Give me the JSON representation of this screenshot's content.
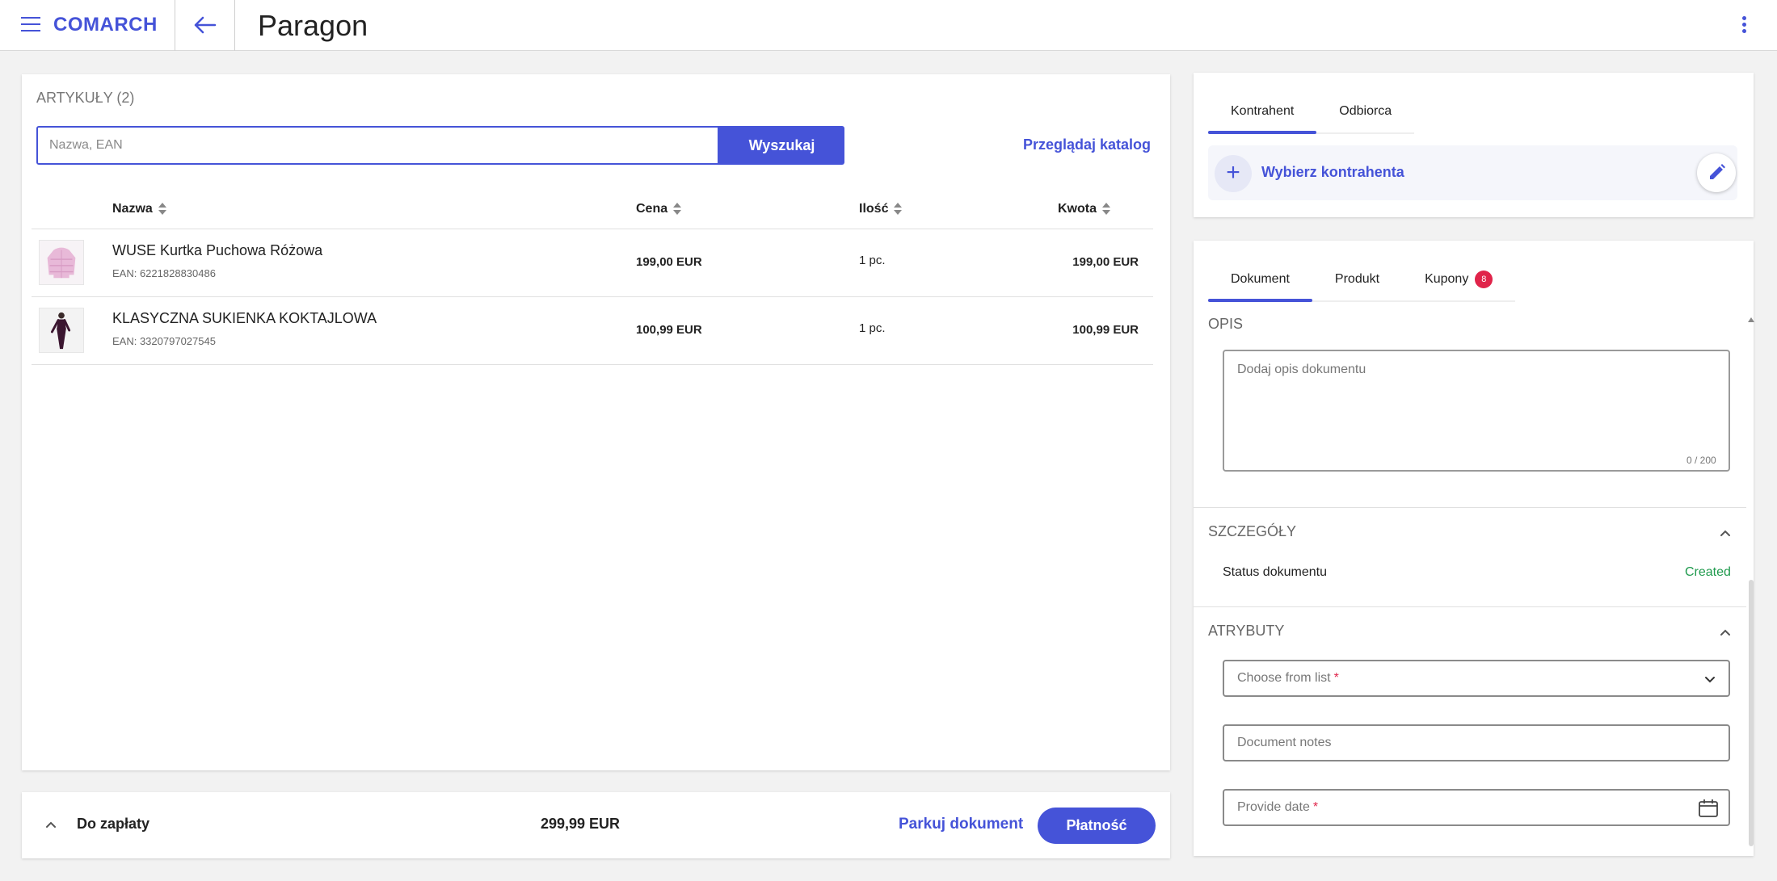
{
  "header": {
    "logo": "COMARCH",
    "title": "Paragon"
  },
  "articles": {
    "heading": "ARTYKUŁY (2)",
    "search_placeholder": "Nazwa, EAN",
    "search_button": "Wyszukaj",
    "catalog_link": "Przeglądaj katalog",
    "columns": {
      "name": "Nazwa",
      "price": "Cena",
      "qty": "Ilość",
      "amount": "Kwota"
    },
    "items": [
      {
        "name": "WUSE Kurtka Puchowa Różowa",
        "ean": "EAN: 6221828830486",
        "price": "199,00 EUR",
        "qty": "1 pc.",
        "amount": "199,00 EUR"
      },
      {
        "name": "KLASYCZNA SUKIENKA KOKTAJLOWA",
        "ean": "EAN: 3320797027545",
        "price": "100,99 EUR",
        "qty": "1 pc.",
        "amount": "100,99 EUR"
      }
    ]
  },
  "footer": {
    "due_label": "Do zapłaty",
    "due_amount": "299,99 EUR",
    "park_label": "Parkuj dokument",
    "pay_label": "Płatność"
  },
  "contractor": {
    "tabs": [
      "Kontrahent",
      "Odbiorca"
    ],
    "choose_label": "Wybierz kontrahenta"
  },
  "document": {
    "tabs": [
      "Dokument",
      "Produkt",
      "Kupony"
    ],
    "coupons_badge": "8",
    "description_title": "OPIS",
    "description_placeholder": "Dodaj opis dokumentu",
    "description_counter": "0 / 200",
    "details_title": "SZCZEGÓŁY",
    "status_label": "Status dokumentu",
    "status_value": "Created",
    "attributes_title": "ATRYBUTY",
    "choose_list_placeholder": "Choose from list",
    "notes_placeholder": "Document notes",
    "date_placeholder": "Provide date",
    "required_mark": "*"
  },
  "colors": {
    "accent": "#4553d8",
    "status_created": "#1f9a4d",
    "badge": "#e0244a"
  }
}
